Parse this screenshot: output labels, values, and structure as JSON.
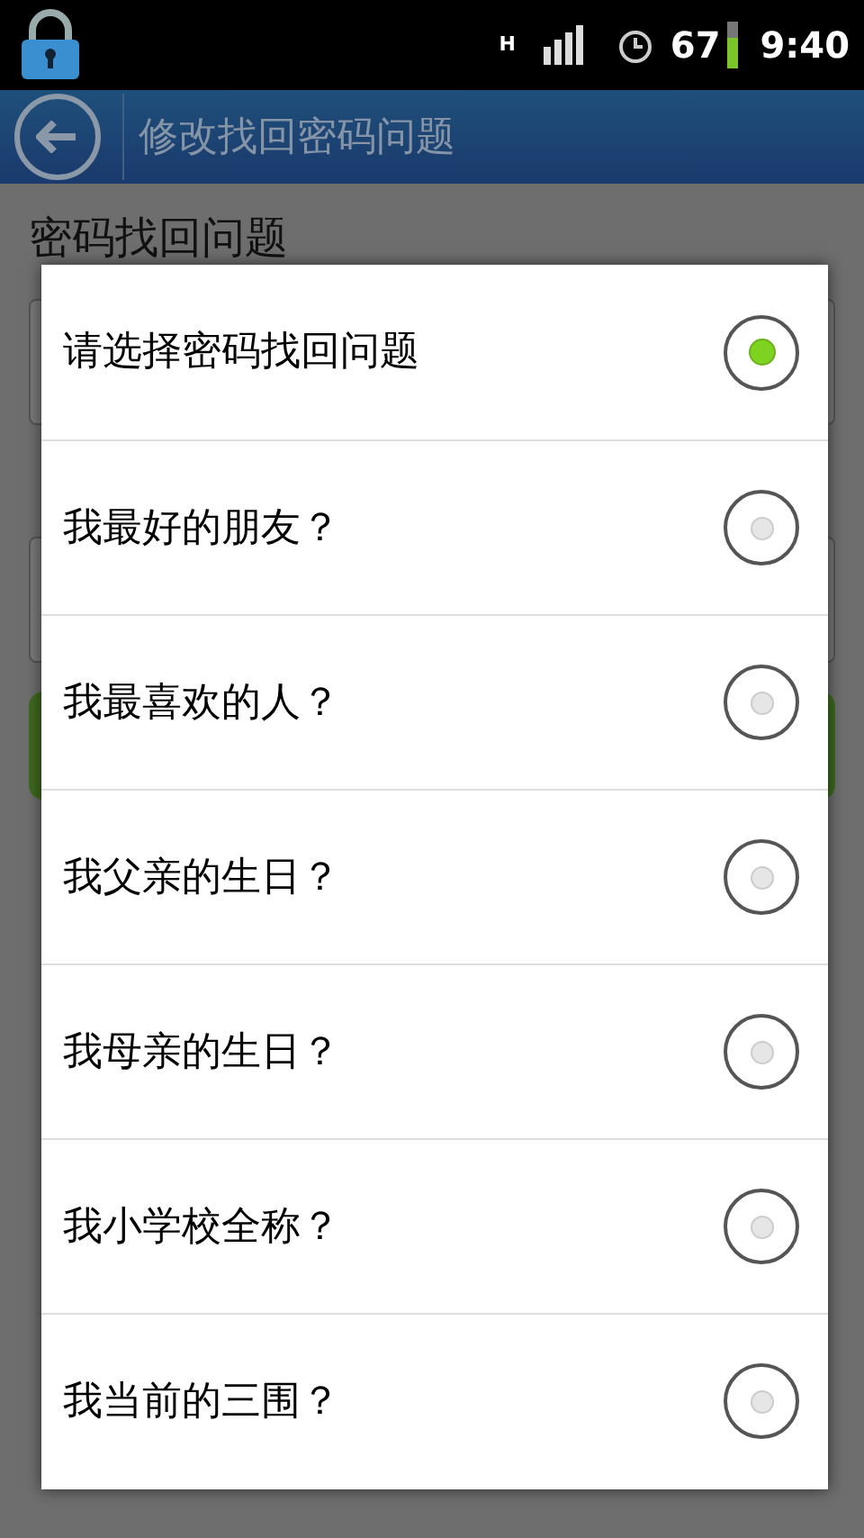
{
  "status_bar": {
    "network": "H",
    "battery": "67",
    "time": "9:40"
  },
  "header": {
    "title": "修改找回密码问题"
  },
  "form": {
    "label": "密码找回问题"
  },
  "dialog": {
    "options": [
      {
        "label": "请选择密码找回问题",
        "selected": true
      },
      {
        "label": "我最好的朋友？",
        "selected": false
      },
      {
        "label": "我最喜欢的人？",
        "selected": false
      },
      {
        "label": "我父亲的生日？",
        "selected": false
      },
      {
        "label": "我母亲的生日？",
        "selected": false
      },
      {
        "label": "我小学校全称？",
        "selected": false
      },
      {
        "label": "我当前的三围？",
        "selected": false
      }
    ]
  }
}
